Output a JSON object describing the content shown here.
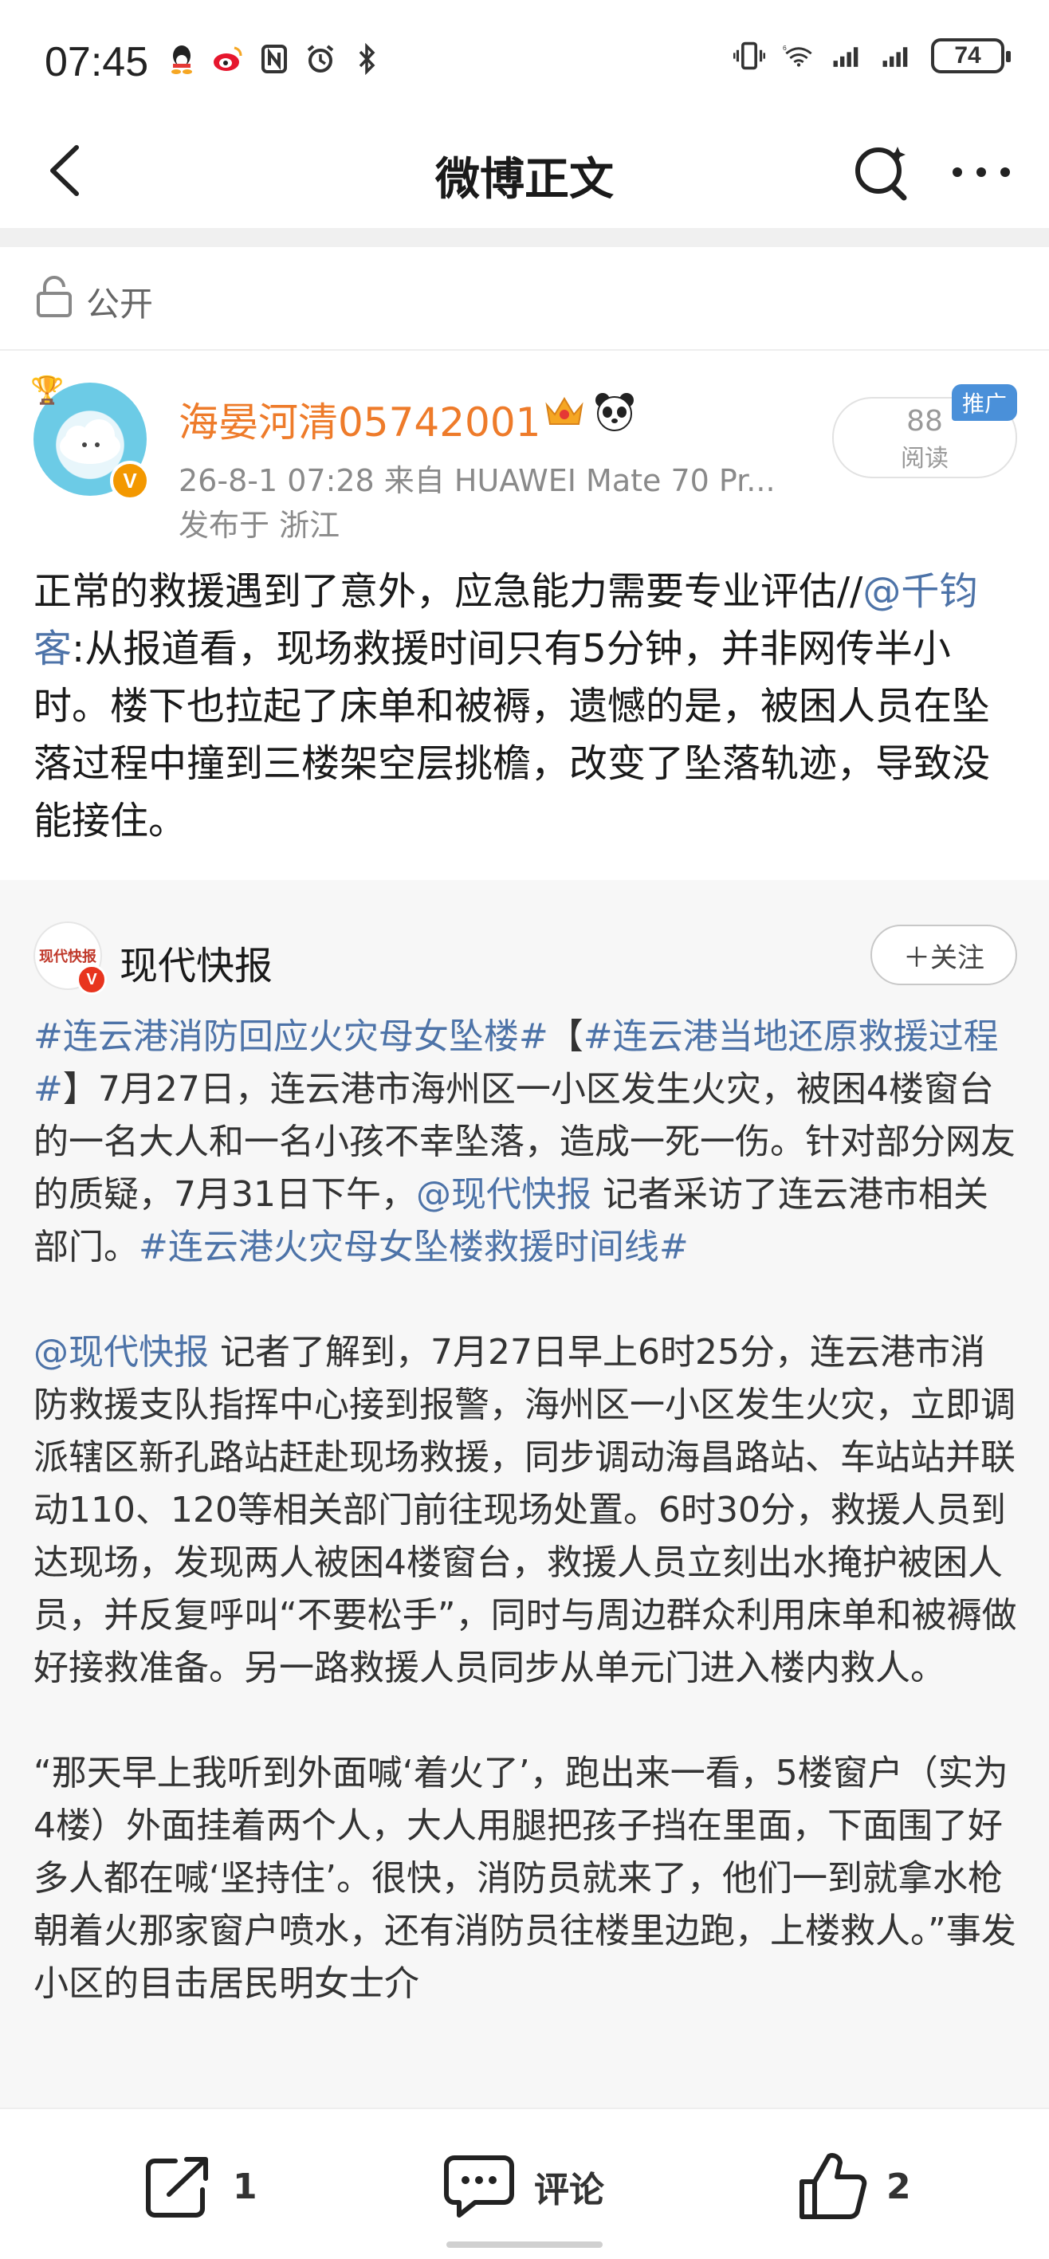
{
  "status_bar": {
    "time": "07:45",
    "battery": "74",
    "left_icons": [
      "qq-icon",
      "weibo-icon",
      "nfc-icon",
      "alarm-icon",
      "bluetooth-icon"
    ],
    "right_icons": [
      "vibrate-icon",
      "wifi-6-icon",
      "signal-icon",
      "signal-icon"
    ]
  },
  "nav": {
    "title": "微博正文"
  },
  "visibility": {
    "label": "公开"
  },
  "author": {
    "name": "海晏河清05742001",
    "meta": "26-8-1 07:28   来自 HUAWEI Mate 70 Pr...",
    "location": "发布于 浙江",
    "read_count": "88",
    "read_label": "阅读",
    "promo_tag": "推广"
  },
  "post": {
    "text_1": "正常的救援遇到了意外，应急能力需要专业评估//",
    "mention": "@千钧客",
    "text_2": ":从报道看，现场救援时间只有5分钟，并非网传半小时。楼下也拉起了床单和被褥，遗憾的是，被困人员在坠落过程中撞到三楼架空层挑檐，改变了坠落轨迹，导致没能接住。"
  },
  "retweet": {
    "avatar_text": "现代快报",
    "source_name": "现代快报",
    "follow_label": "＋关注",
    "p1": {
      "tag1": "#连云港消防回应火灾母女坠楼#",
      "t1": "【",
      "tag2": "#连云港当地还原救援过程#",
      "t2": "】7月27日，连云港市海州区一小区发生火灾，被困4楼窗台的一名大人和一名小孩不幸坠落，造成一死一伤。针对部分网友的质疑，7月31日下午，",
      "mention": "@现代快报",
      "t3": " 记者采访了连云港市相关部门。",
      "tag3": "#连云港火灾母女坠楼救援时间线#"
    },
    "p2": {
      "mention": "@现代快报",
      "t1": " 记者了解到，7月27日早上6时25分，连云港市消防救援支队指挥中心接到报警，海州区一小区发生火灾，立即调派辖区新孔路站赶赴现场救援，同步调动海昌路站、车站站并联动110、120等相关部门前往现场处置。6时30分，救援人员到达现场，发现两人被困4楼窗台，救援人员立刻出水掩护被困人员，并反复呼叫“不要松手”，同时与周边群众利用床单和被褥做好接救准备。另一路救援人员同步从单元门进入楼内救人。"
    },
    "p3": "“那天早上我听到外面喊‘着火了’，跑出来一看，5楼窗户（实为4楼）外面挂着两个人，大人用腿把孩子挡在里面，下面围了好多人都在喊‘坚持住’。很快，消防员就来了，他们一到就拿水枪朝着火那家窗户喷水，还有消防员往楼里边跑，上楼救人。”事发小区的目击居民明女士介"
  },
  "bottom_bar": {
    "share_count": "1",
    "comment_label": "评论",
    "like_count": "2"
  }
}
